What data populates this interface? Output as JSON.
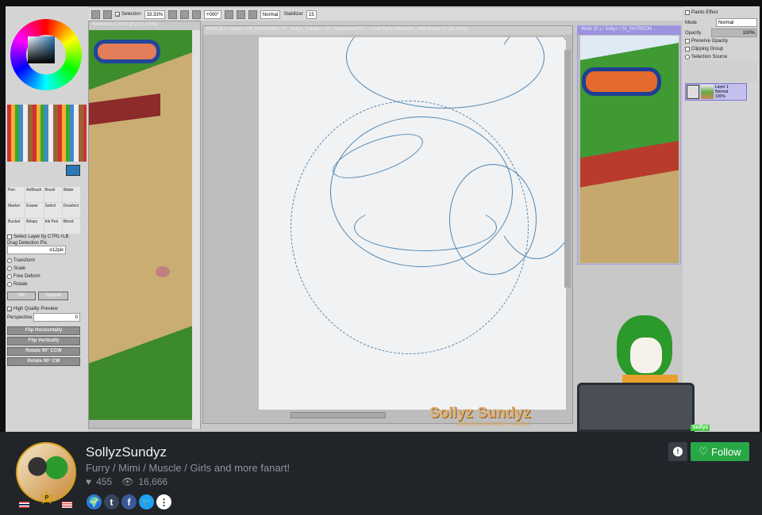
{
  "sai": {
    "toolbar": {
      "selection_label": "Selection",
      "zoom": "33.33%",
      "rotation": "+000°",
      "blend_mode": "Normal",
      "stabilizer_label": "Stabilizer",
      "stabilizer_value": "15"
    },
    "left_window_title": "Renekton Color3.png (*) (25%)",
    "main_window_title": "Work (E:) / Sollyz / 02_PATREON / PT_Sollyz_Sundyz / 24_September2017 / Pool Party Renekton_NSFW.psd (*) (33.33%)",
    "right_window_title": "Work (E:) / Sollyz / 02_PATREON ...",
    "tools": [
      "Pen",
      "AirBrush",
      "Brush",
      "Water",
      "Marker",
      "Eraser",
      "Select",
      "Deselect",
      "Bucket",
      "Binary",
      "Ink Pen",
      "Blend"
    ],
    "select_layer_label": "Select Layer by CTRL+LB",
    "drag_detection_label": "Drag Detection Pix.",
    "drag_detection_value": "±12pix",
    "transform_options": [
      "Transform",
      "Scale",
      "Free Deform",
      "Rotate"
    ],
    "ok_label": "OK",
    "cancel_label": "Cancel",
    "hq_preview_label": "High Quality Preview",
    "perspective_label": "Perspective",
    "perspective_value": "0",
    "transform_buttons": [
      "Flip Horizontally",
      "Flip Vertically",
      "Rotate 90° CCW",
      "Rotate 90° CW"
    ],
    "layers_panel": {
      "paints_effect": "Paints Effect",
      "mode_label": "Mode",
      "mode_value": "Normal",
      "opacity_label": "Opacity",
      "opacity_value": "100%",
      "preserve_opacity": "Preserve Opacity",
      "clipping_group": "Clipping Group",
      "selection_source": "Selection Source",
      "layer_name": "Layer 1",
      "layer_mode": "Normal",
      "layer_opacity": "100%"
    },
    "watermark": {
      "name": "Sollyz Sundyz",
      "url": "patreon.com/sollyz_sundyz"
    },
    "cam_label": "Sollyz"
  },
  "channel": {
    "name": "SollyzSundyz",
    "description": "Furry / Mimi / Muscle / Girls and more fanart!",
    "likes": "455",
    "views": "16,666",
    "follow_label": "Follow",
    "report_icon": "!",
    "badge_letter": "P",
    "socials": [
      "globe-icon",
      "tumblr-icon",
      "facebook-icon",
      "twitter-icon",
      "more-icon"
    ],
    "follow_color": "#28a745"
  }
}
